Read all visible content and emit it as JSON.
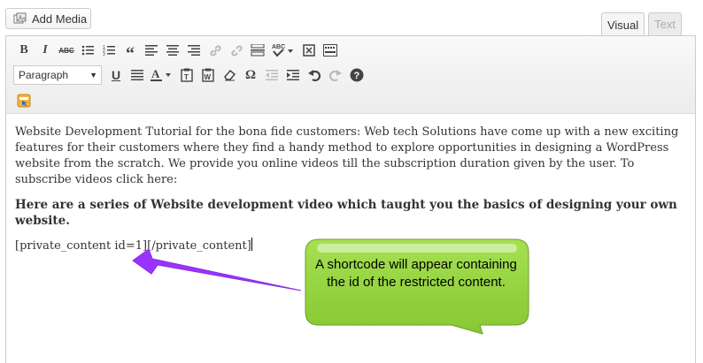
{
  "header": {
    "add_media_label": "Add Media"
  },
  "tabs": [
    {
      "label": "Visual",
      "active": true
    },
    {
      "label": "Text",
      "active": false
    }
  ],
  "toolbar": {
    "format_select": "Paragraph",
    "row1_icons": [
      "bold-icon",
      "italic-icon",
      "strikethrough-icon",
      "bullet-list-icon",
      "numbered-list-icon",
      "blockquote-icon",
      "align-left-icon",
      "align-center-icon",
      "align-right-icon",
      "link-icon",
      "unlink-icon",
      "insert-more-icon",
      "spellcheck-icon",
      "fullscreen-icon",
      "toolbar-toggle-icon"
    ],
    "row2_icons": [
      "underline-icon",
      "justify-icon",
      "text-color-icon",
      "paste-text-icon",
      "paste-word-icon",
      "clear-formatting-icon",
      "special-character-icon",
      "outdent-icon",
      "indent-icon",
      "undo-icon",
      "redo-icon",
      "help-icon"
    ]
  },
  "content": {
    "paragraph1": "Website Development Tutorial for the bona fide customers: Web tech Solutions have come up with a new exciting features for their customers where they find a handy method to explore opportunities in designing a WordPress website from the scratch. We provide you online videos till the subscription duration given by the user. To subscribe videos click here:",
    "paragraph2": "Here are a series of Website development video which taught you the basics of designing your own website.",
    "shortcode": "[private_content id=1][/private_content]"
  },
  "callout": {
    "text": "A shortcode will appear containing the id of the restricted content.",
    "fill_color": "#8ed43a",
    "arrow_color": "#9933ff"
  },
  "colors": {
    "accent": "#21759b"
  }
}
